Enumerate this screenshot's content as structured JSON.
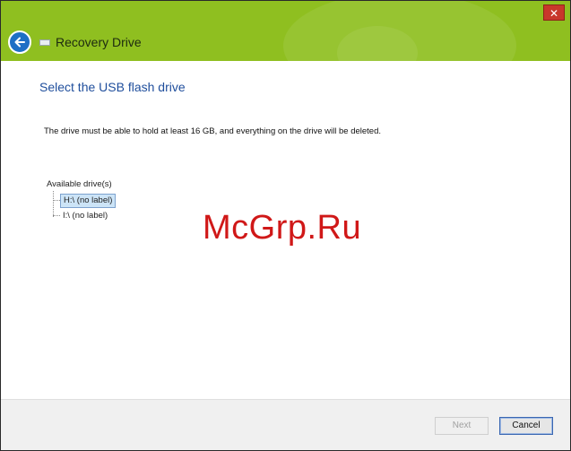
{
  "window": {
    "title": "Recovery Drive",
    "close_glyph": "✕",
    "accent_color": "#8fbf20"
  },
  "icons": {
    "back": "back-arrow-icon",
    "drive": "drive-icon",
    "close": "close-icon"
  },
  "main": {
    "heading": "Select the USB flash drive",
    "description": "The drive must be able to hold at least 16 GB, and everything on the drive will be deleted.",
    "drives_label": "Available drive(s)",
    "drives": [
      {
        "label": "H:\\ (no label)",
        "selected": true
      },
      {
        "label": "I:\\ (no label)",
        "selected": false
      }
    ]
  },
  "footer": {
    "next_label": "Next",
    "cancel_label": "Cancel"
  },
  "watermark": "McGrp.Ru"
}
